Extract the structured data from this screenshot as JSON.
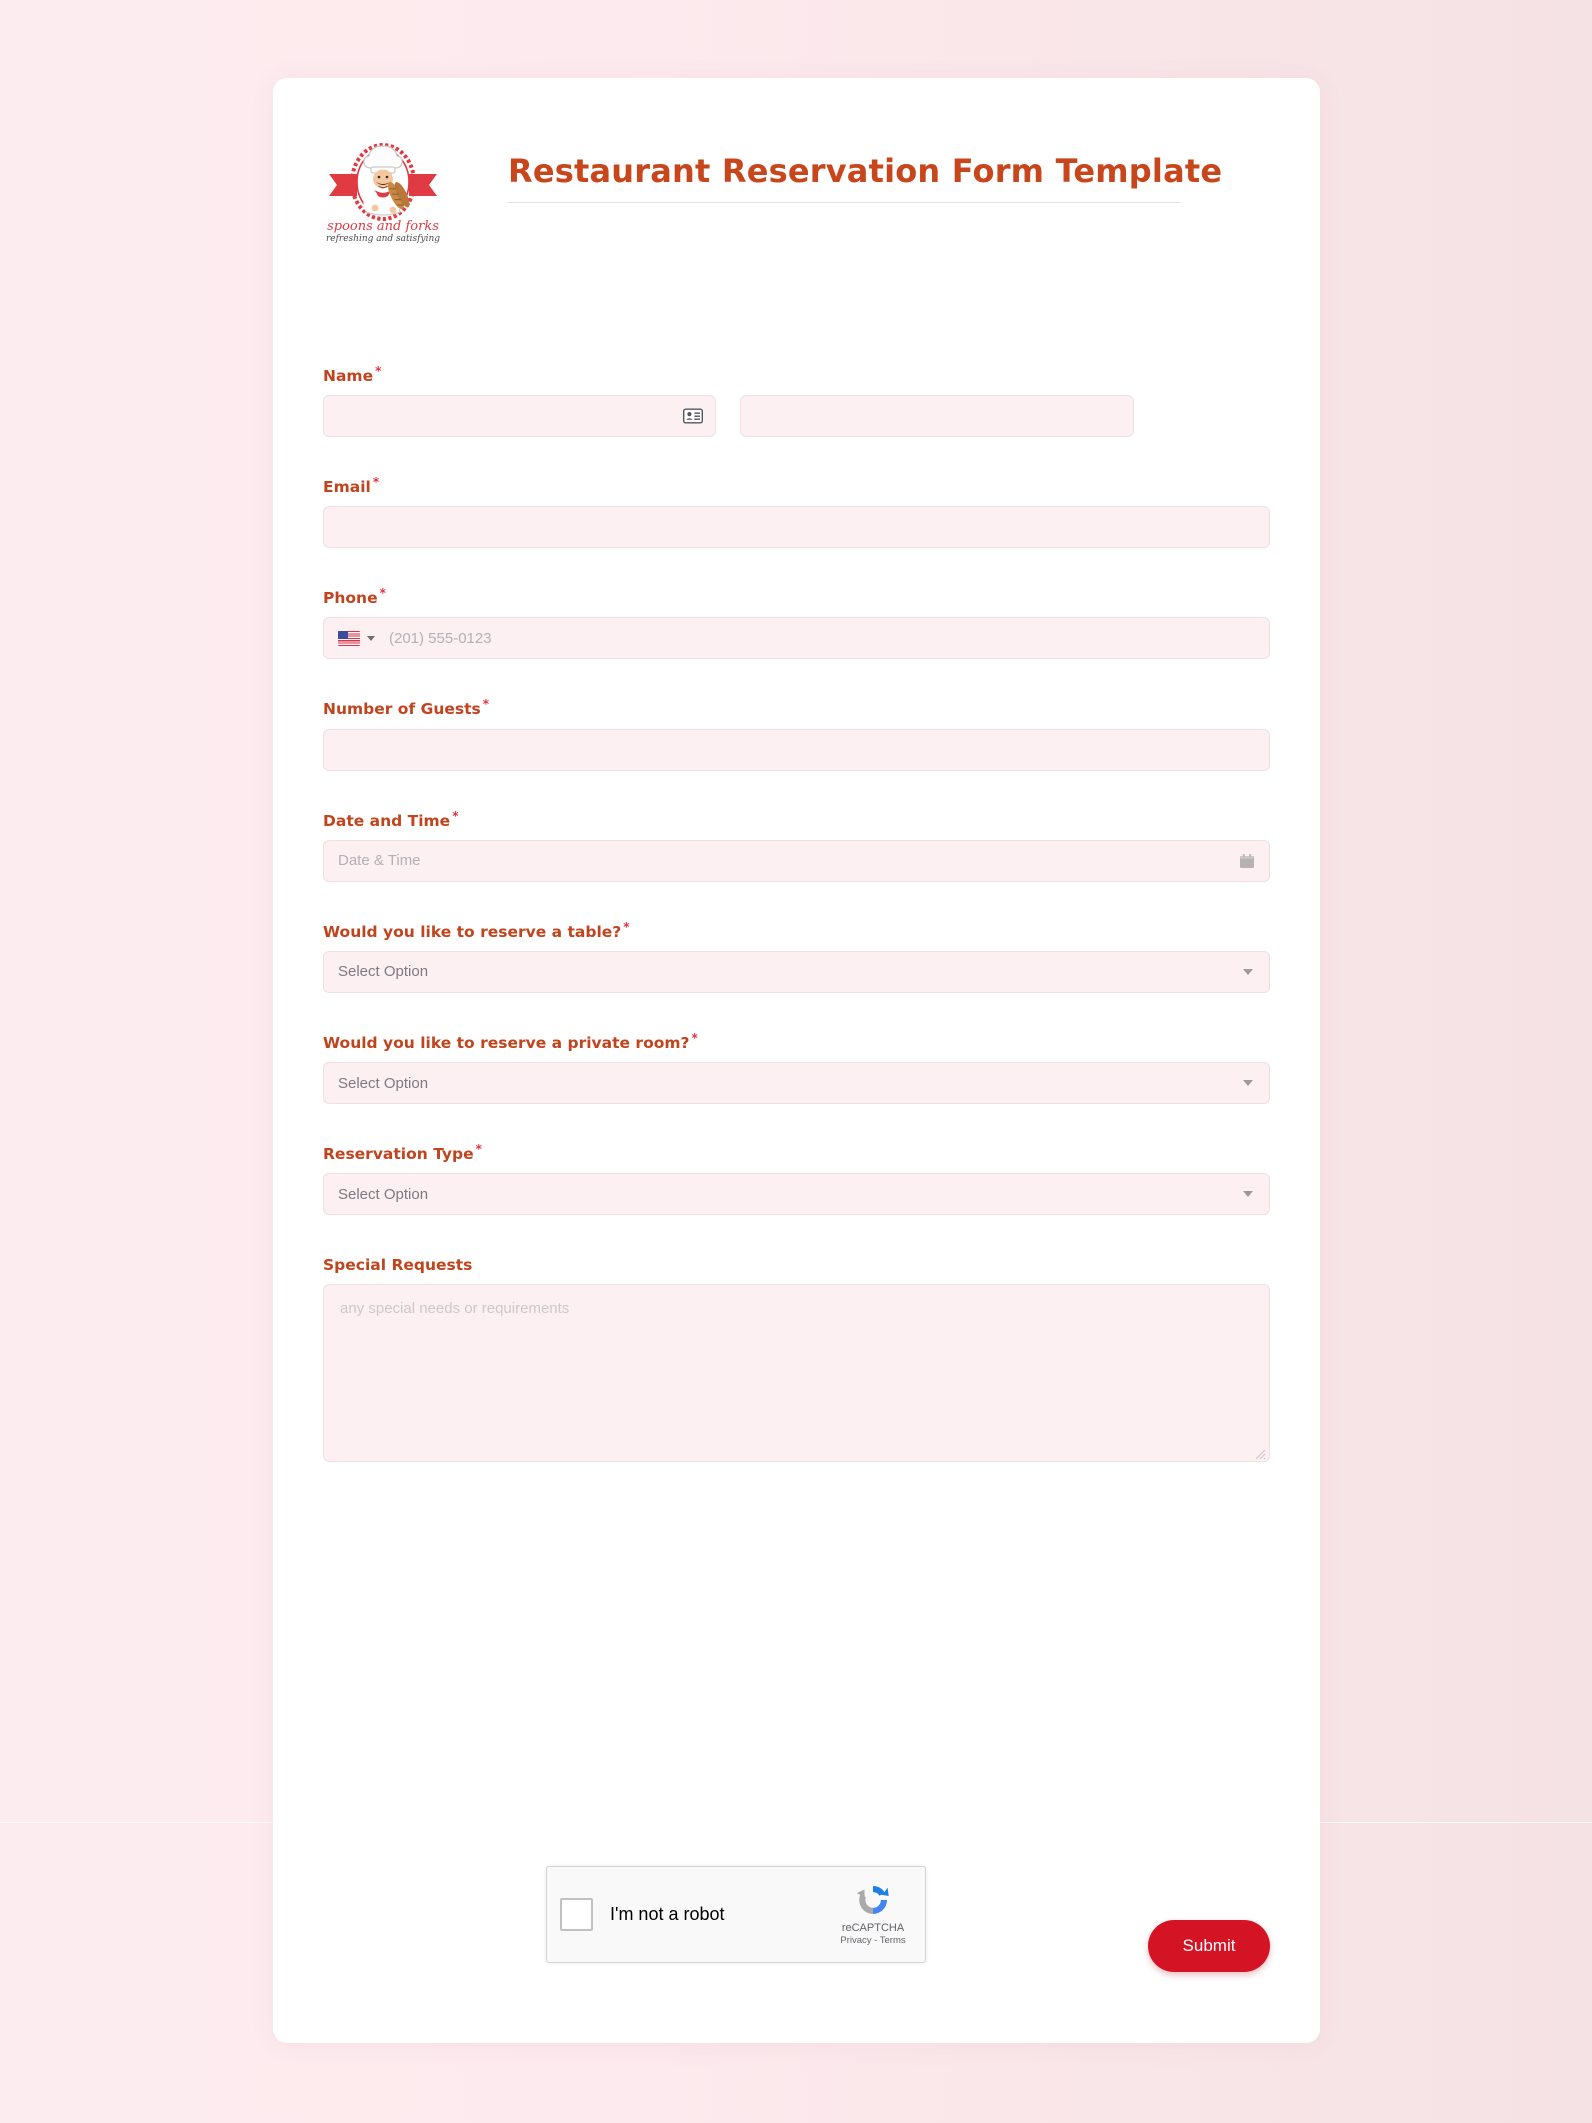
{
  "page": {
    "background_color": "#fceaee",
    "card_color": "#ffffff"
  },
  "header": {
    "title": "Restaurant Reservation Form Template",
    "title_color": "#c8461c",
    "logo": {
      "name": "spoons-and-forks-logo",
      "brand_name": "spoons and forks",
      "tagline": "refreshing and satisfying",
      "brand_color": "#e03a42"
    }
  },
  "fields": {
    "name": {
      "label": "Name",
      "required_mark": "*",
      "first_value": "",
      "last_value": "",
      "first_placeholder": "",
      "last_placeholder": "",
      "icon": "contact-card-icon"
    },
    "email": {
      "label": "Email",
      "required_mark": "*",
      "value": "",
      "placeholder": ""
    },
    "phone": {
      "label": "Phone",
      "required_mark": "*",
      "value": "",
      "placeholder": "(201) 555-0123",
      "country_flag": "us-flag-icon"
    },
    "guests": {
      "label": "Number of Guests",
      "required_mark": "*",
      "value": "",
      "placeholder": ""
    },
    "datetime": {
      "label": "Date and Time",
      "required_mark": "*",
      "value": "",
      "placeholder": "Date & Time",
      "icon": "calendar-icon"
    },
    "reserve_table": {
      "label": "Would you like to reserve a table?",
      "required_mark": "*",
      "selected": "Select Option"
    },
    "reserve_private_room": {
      "label": "Would you like to reserve a private room?",
      "required_mark": "*",
      "selected": "Select Option"
    },
    "reservation_type": {
      "label": "Reservation Type",
      "required_mark": "*",
      "selected": "Select Option"
    },
    "special_requests": {
      "label": "Special Requests",
      "required_mark": "",
      "value": "",
      "placeholder": "any special needs or requirements"
    }
  },
  "captcha": {
    "checkbox_label": "I'm not a robot",
    "brand": "reCAPTCHA",
    "terms": "Privacy - Terms"
  },
  "actions": {
    "submit_label": "Submit",
    "submit_color": "#d41425"
  }
}
